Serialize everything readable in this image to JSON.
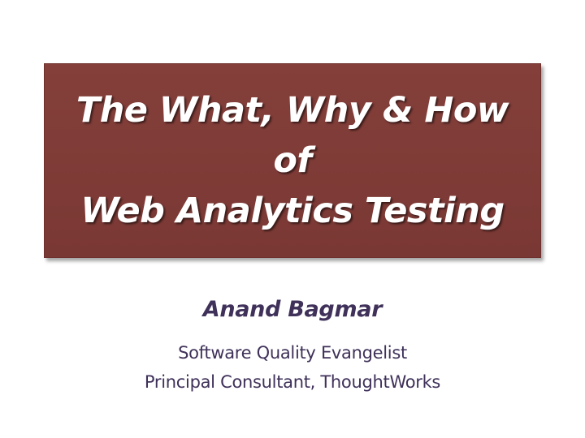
{
  "title": {
    "lines": [
      "The What, Why & How",
      "of",
      "Web Analytics Testing"
    ]
  },
  "author": {
    "name": "Anand Bagmar",
    "roles": [
      "Software Quality Evangelist",
      "Principal Consultant, ThoughtWorks"
    ]
  },
  "colors": {
    "title_box": "#7e3b36",
    "title_text": "#ffffff",
    "author_text": "#3f3159",
    "background": "#ffffff"
  }
}
